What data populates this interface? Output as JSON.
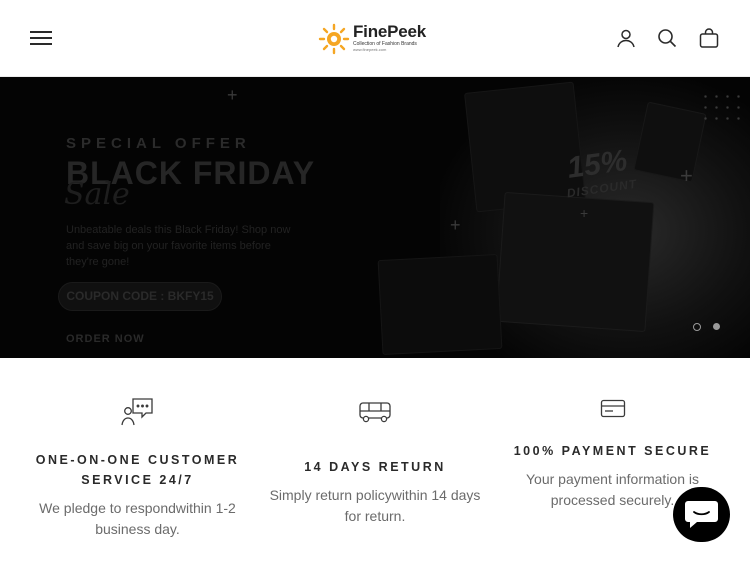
{
  "header": {
    "brand": "FinePeek",
    "tagline": "Collection of Fashion Brands",
    "url": "www.finepeek.com"
  },
  "hero": {
    "eyebrow": "SPECIAL OFFER",
    "title": "BLACK FRIDAY",
    "script": "Sale",
    "description": "Unbeatable deals this Black Friday! Shop now and save big on your favorite items before they're gone!",
    "coupon": "COUPON CODE : BKFY15",
    "cta": "ORDER NOW",
    "badge_percent": "15%",
    "badge_label": "DISCOUNT",
    "slide_count": 2,
    "active_slide": 1
  },
  "features": [
    {
      "icon": "chat-support-icon",
      "title": "ONE-ON-ONE CUSTOMER SERVICE 24/7",
      "desc": "We pledge to respondwithin 1-2 business day."
    },
    {
      "icon": "delivery-truck-icon",
      "title": "14 DAYS RETURN",
      "desc": "Simply return policywithin 14 days for return."
    },
    {
      "icon": "credit-card-icon",
      "title": "100% PAYMENT SECURE",
      "desc": "Your payment information is processed securely."
    }
  ],
  "colors": {
    "accent": "#f5a623",
    "hero_bg": "#040404",
    "text_muted": "#6b6b6b"
  }
}
